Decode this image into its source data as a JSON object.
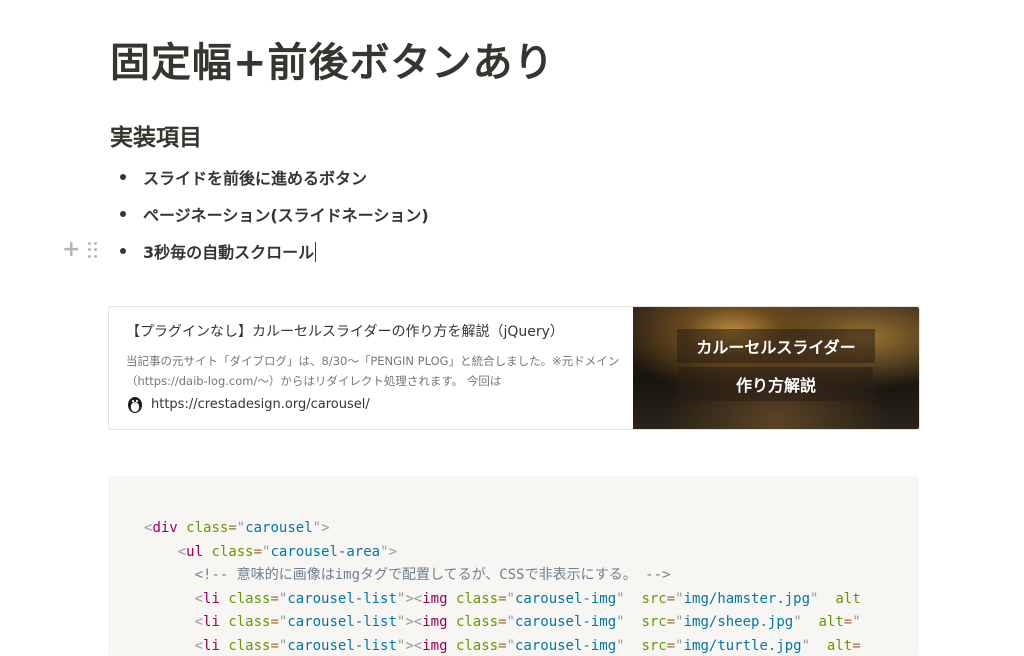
{
  "page": {
    "title": "固定幅+前後ボタンあり"
  },
  "section": {
    "heading": "実装項目",
    "bullets": [
      "スライドを前後に進めるボタン",
      "ページネーション(スライドネーション)",
      "3秒毎の自動スクロール"
    ]
  },
  "bookmark": {
    "title": "【プラグインなし】カルーセルスライダーの作り方を解説（jQuery）",
    "description": "当記事の元サイト「ダイブログ」は、8/30〜「PENGIN PLOG」と統合しました。※元ドメイン（https://daib-log.com/〜）からはリダイレクト処理されます。 今回は",
    "url": "https://crestadesign.org/carousel/",
    "image_line1": "カルーセルスライダー",
    "image_line2": "作り方解説"
  },
  "code": {
    "line1": {
      "tag": "div",
      "attr": "class",
      "value": "carousel"
    },
    "line2": {
      "tag": "ul",
      "attr": "class",
      "value": "carousel-area"
    },
    "comment": "<!-- 意味的に画像はimgタグで配置してるが、CSSで非表示にする。 -->",
    "list_items": [
      {
        "li_attr": "class",
        "li_value": "carousel-list",
        "img_tag": "img",
        "img_class_attr": "class",
        "img_class": "carousel-img",
        "src_attr": "src",
        "src": "img/hamster.jpg",
        "alt_attr": "alt"
      },
      {
        "li_attr": "class",
        "li_value": "carousel-list",
        "img_tag": "img",
        "img_class_attr": "class",
        "img_class": "carousel-img",
        "src_attr": "src",
        "src": "img/sheep.jpg",
        "alt_attr": "alt"
      },
      {
        "li_attr": "class",
        "li_value": "carousel-list",
        "img_tag": "img",
        "img_class_attr": "class",
        "img_class": "carousel-img",
        "src_attr": "src",
        "src": "img/turtle.jpg",
        "alt_attr": "alt"
      }
    ],
    "li_tag": "li"
  },
  "icons": {
    "block_add": "plus-icon",
    "block_drag": "drag-handle-icon",
    "favicon": "penguin-icon"
  }
}
